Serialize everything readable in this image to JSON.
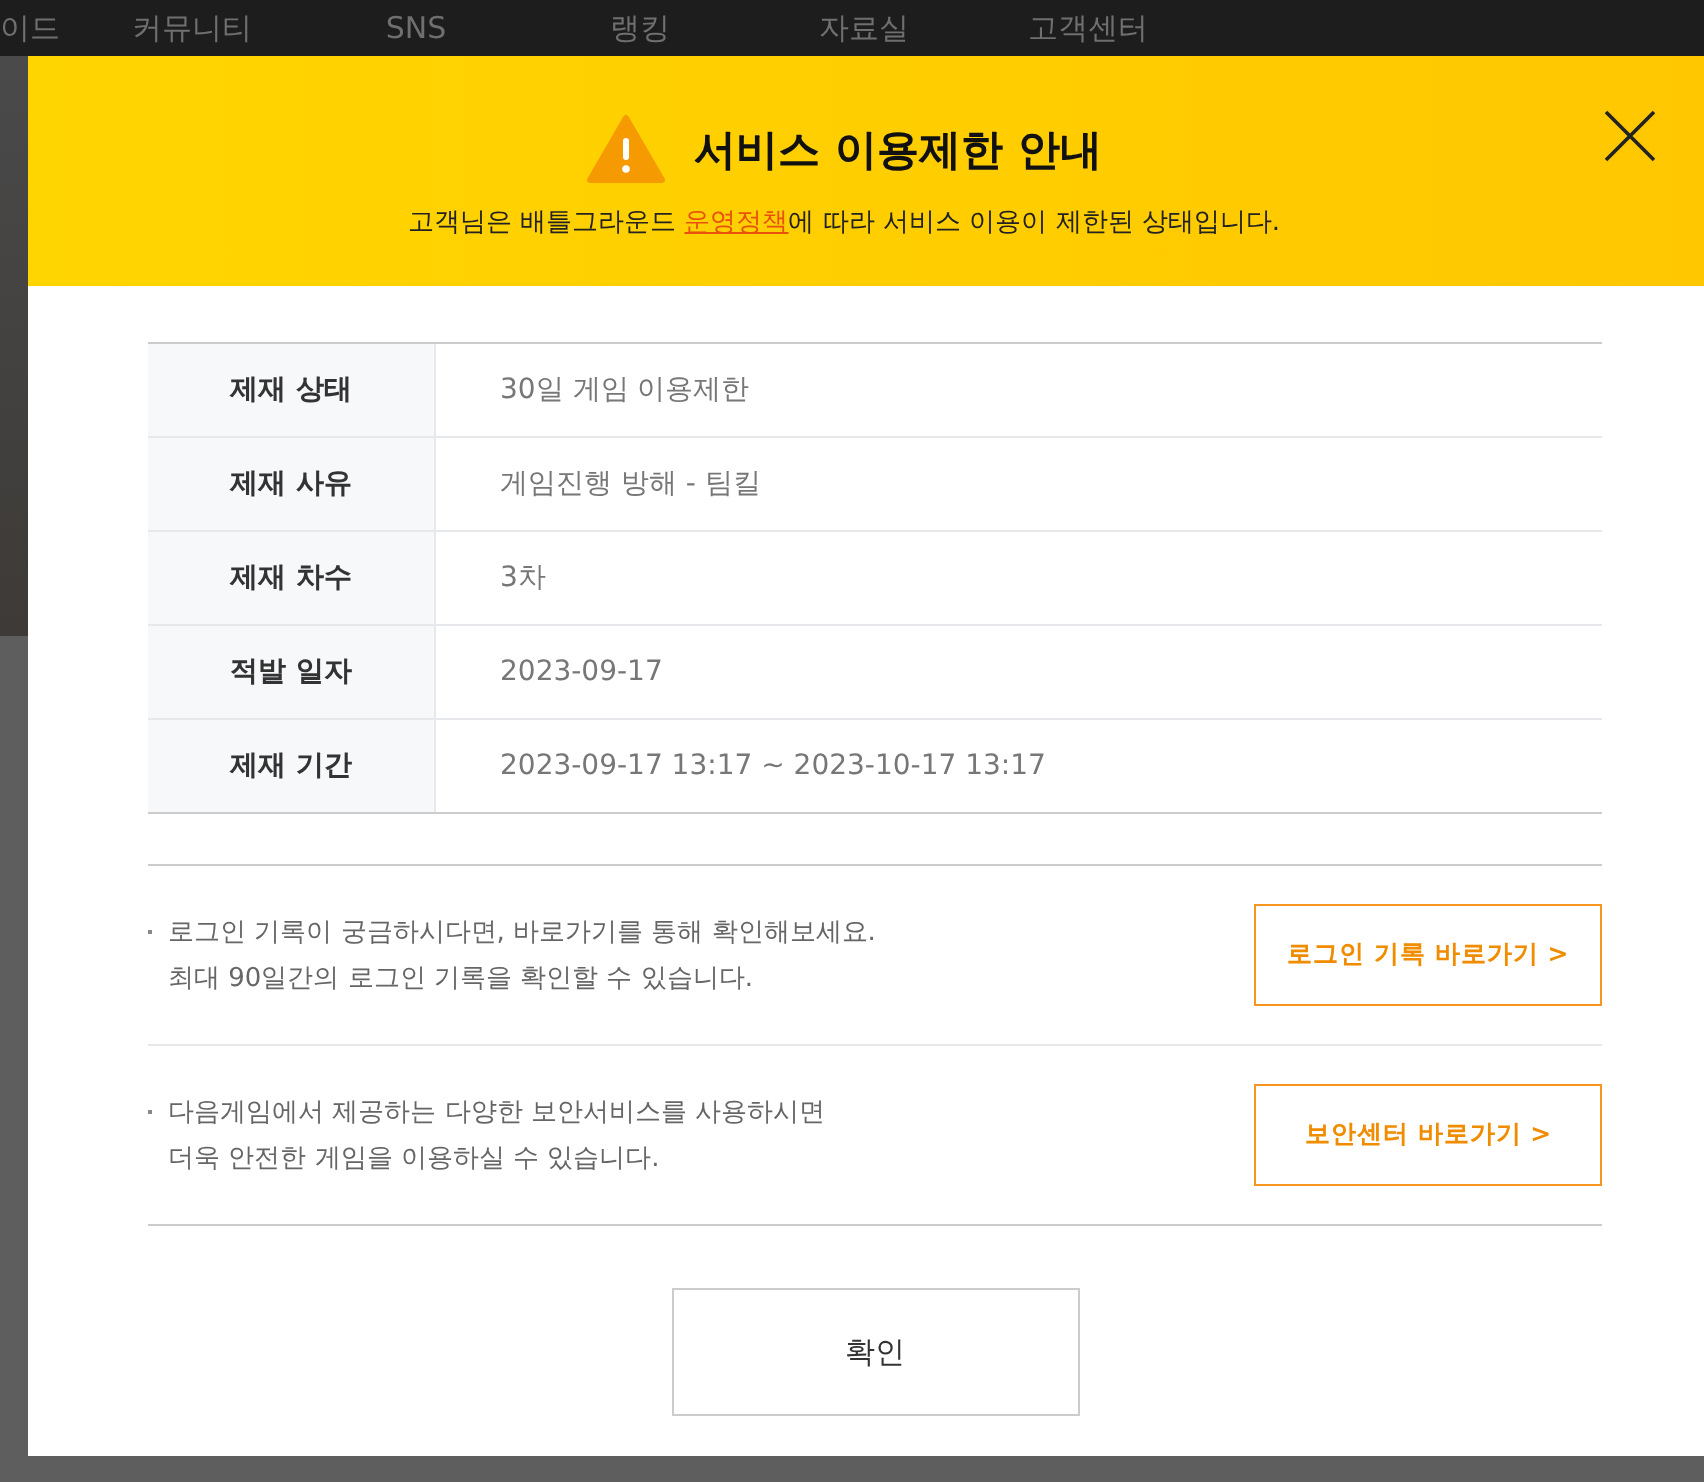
{
  "nav": {
    "items": [
      "이드",
      "커뮤니티",
      "SNS",
      "랭킹",
      "자료실",
      "고객센터"
    ]
  },
  "dialog": {
    "title": "서비스 이용제한 안내",
    "subtitle_before": "고객님은 배틀그라운드 ",
    "policy_link": "운영정책",
    "subtitle_after": "에 따라 서비스 이용이 제한된 상태입니다.",
    "details": [
      {
        "label": "제재 상태",
        "value": "30일 게임 이용제한"
      },
      {
        "label": "제재 사유",
        "value": "게임진행 방해 - 팀킬"
      },
      {
        "label": "제재 차수",
        "value": "3차"
      },
      {
        "label": "적발 일자",
        "value": "2023-09-17"
      },
      {
        "label": "제재 기간",
        "value": "2023-09-17 13:17 ~ 2023-10-17 13:17"
      }
    ],
    "notices": [
      {
        "lines": [
          "로그인 기록이 궁금하시다면, 바로가기를 통해 확인해보세요.",
          "최대 90일간의 로그인 기록을 확인할 수 있습니다."
        ],
        "button": "로그인 기록 바로가기 >"
      },
      {
        "lines": [
          "다음게임에서 제공하는 다양한 보안서비스를 사용하시면",
          "더욱 안전한 게임을 이용하실 수 있습니다."
        ],
        "button": "보안센터 바로가기 >"
      }
    ],
    "confirm": "확인"
  }
}
